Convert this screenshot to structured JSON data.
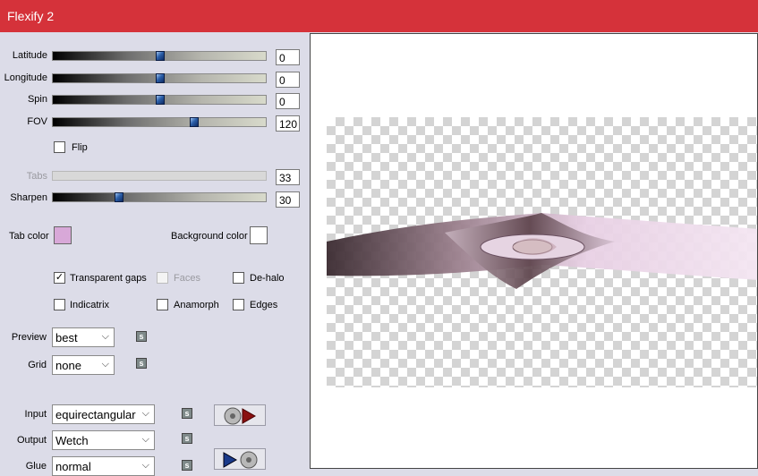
{
  "window": {
    "title": "Flexify 2"
  },
  "sliders": {
    "latitude": {
      "label": "Latitude",
      "value": "0",
      "level": 0.5
    },
    "longitude": {
      "label": "Longitude",
      "value": "0",
      "level": 0.5
    },
    "spin": {
      "label": "Spin",
      "value": "0",
      "level": 0.5
    },
    "fov": {
      "label": "FOV",
      "value": "120",
      "level": 0.67
    },
    "tabs": {
      "label": "Tabs",
      "value": "33",
      "disabled": true
    },
    "sharpen": {
      "label": "Sharpen",
      "value": "30",
      "level": 0.3
    }
  },
  "flip": {
    "label": "Flip",
    "checked": false
  },
  "tab_color": {
    "label": "Tab color",
    "color": "#d8a8d8"
  },
  "background_color": {
    "label": "Background color",
    "color": "#ffffff"
  },
  "options": {
    "transparent_gaps": {
      "label": "Transparent gaps",
      "checked": true
    },
    "faces": {
      "label": "Faces",
      "checked": false,
      "disabled": true
    },
    "de_halo": {
      "label": "De-halo",
      "checked": false
    },
    "indicatrix": {
      "label": "Indicatrix",
      "checked": false
    },
    "anamorph": {
      "label": "Anamorph",
      "checked": false
    },
    "edges": {
      "label": "Edges",
      "checked": false
    }
  },
  "preview_select": {
    "label": "Preview",
    "value": "best"
  },
  "grid_select": {
    "label": "Grid",
    "value": "none"
  },
  "input_select": {
    "label": "Input",
    "value": "equirectangular"
  },
  "output_select": {
    "label": "Output",
    "value": "Wetch"
  },
  "glue_select": {
    "label": "Glue",
    "value": "normal"
  },
  "icons": {
    "link": "link-icon",
    "input_preset": "disc-arrow-icon",
    "output_preset": "arrow-disc-icon",
    "chevron": "⌵"
  },
  "colors": {
    "titlebar": "#d5323a",
    "panel": "#dcdce8"
  }
}
